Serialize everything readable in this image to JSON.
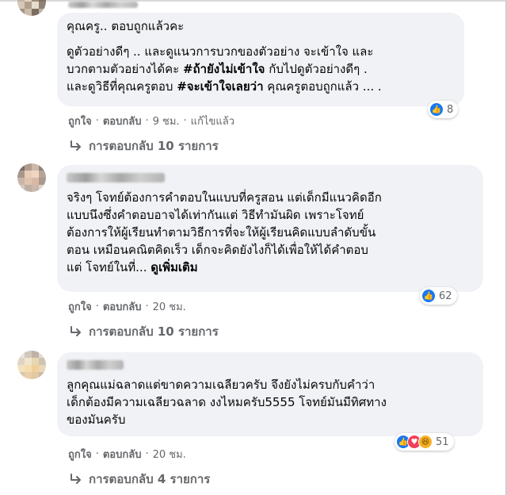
{
  "comments": [
    {
      "body_line1": "คุณครู.. ตอบถูกแล้วคะ",
      "body_para2_pre": "ดูตัวอย่างดีๆ .. และดูแนวการบวกของตัวอย่าง จะเข้าใจ และ\nบวกตามตัวอย่างได้คะ ",
      "body_tag1": "#ถ้ายังไม่เข้าใจ",
      "body_mid": " กับไปดูตัวอย่างดีๆ .\nและดูวิธีที่คุณครูตอบ ",
      "body_tag2": "#จะเข้าใจเลยว่า",
      "body_post": " คุณครูตอบถูกแล้ว ... .",
      "reaction_count": "8",
      "like": "ถูกใจ",
      "reply": "ตอบกลับ",
      "time": "9 ชม.",
      "edited": "แก้ไขแล้ว",
      "replies": "การตอบกลับ 10 รายการ"
    },
    {
      "body": "จริงๆ โจทย์ต้องการคำตอบในแบบที่ครูสอน แต่เด็กมีแนวคิดอีก\nแบบนึงซึ่งคำตอบอาจได้เท่ากันแต่ วิธีทำมันผิด เพราะโจทย์\nต้องการให้ผู้เรียนทำตามวิธีการที่จะให้ผู้เรียนคิดแบบลำดับขั้น\nตอน เหมือนคณิตคิดเร็ว เด็กจะคิดยังไงก็ได้เพื่อให้ได้คำตอบ\nแต่ โจทย์ในที่... ",
      "see_more": "ดูเพิ่มเติม",
      "reaction_count": "62",
      "like": "ถูกใจ",
      "reply": "ตอบกลับ",
      "time": "20 ชม.",
      "replies": "การตอบกลับ 10 รายการ"
    },
    {
      "body": "ลูกคุณแม่ฉลาดแต่ขาดความเฉลียวครับ จึงยังไม่ครบกับคำว่า\nเด็กต้องมีความเฉลียวฉลาด งงไหมครับ5555 โจทย์มันมีทิศทาง\nของมันครับ",
      "reaction_count": "51",
      "like": "ถูกใจ",
      "reply": "ตอบกลับ",
      "time": "20 ชม.",
      "replies": "การตอบกลับ 4 รายการ"
    }
  ],
  "colors": {
    "bubble": "#f0f2f5",
    "muted_text": "#65676b",
    "like_blue": "#1877f2",
    "love_red": "#f33e58",
    "haha_yellow": "#f7b125"
  },
  "icons": [
    "like-icon",
    "love-icon",
    "haha-icon",
    "reply-arrow-icon"
  ]
}
